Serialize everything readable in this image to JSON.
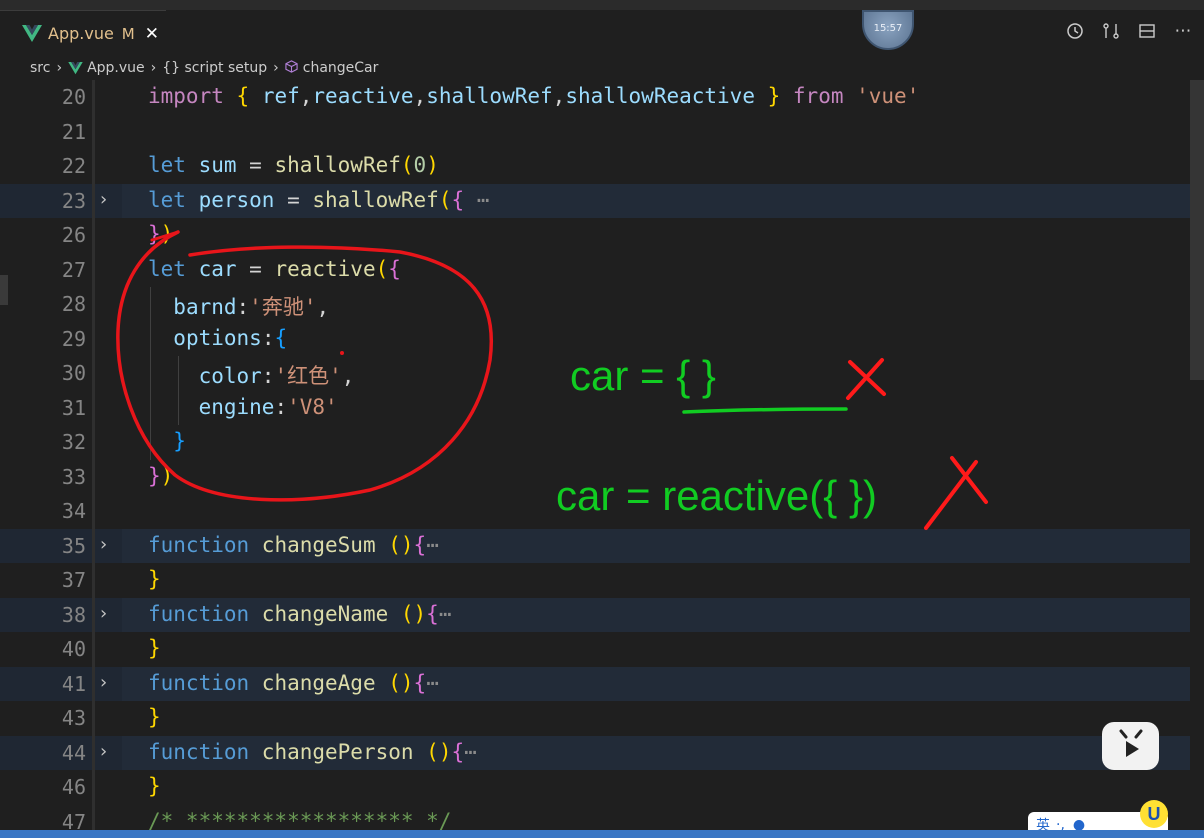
{
  "tab": {
    "filename": "App.vue",
    "modified": "M",
    "close": "✕"
  },
  "clock": {
    "time": "15:57"
  },
  "breadcrumb": {
    "items": [
      "src",
      "App.vue",
      "{} script setup",
      "changeCar"
    ]
  },
  "editor": {
    "lines": [
      {
        "num": "20",
        "folded": false
      },
      {
        "num": "21",
        "folded": false
      },
      {
        "num": "22",
        "folded": false
      },
      {
        "num": "23",
        "folded": true
      },
      {
        "num": "26",
        "folded": false
      },
      {
        "num": "27",
        "folded": false
      },
      {
        "num": "28",
        "folded": false
      },
      {
        "num": "29",
        "folded": false
      },
      {
        "num": "30",
        "folded": false
      },
      {
        "num": "31",
        "folded": false
      },
      {
        "num": "32",
        "folded": false
      },
      {
        "num": "33",
        "folded": false
      },
      {
        "num": "34",
        "folded": false
      },
      {
        "num": "35",
        "folded": true
      },
      {
        "num": "37",
        "folded": false
      },
      {
        "num": "38",
        "folded": true
      },
      {
        "num": "40",
        "folded": false
      },
      {
        "num": "41",
        "folded": true
      },
      {
        "num": "43",
        "folded": false
      },
      {
        "num": "44",
        "folded": true
      },
      {
        "num": "46",
        "folded": false
      },
      {
        "num": "47",
        "folded": false
      }
    ],
    "code": {
      "l20_import": "import",
      "l20_open": "{",
      "l20_ref": " ref",
      "l20_comma1": ",",
      "l20_reactive": "reactive",
      "l20_comma2": ",",
      "l20_shallowRef": "shallowRef",
      "l20_comma3": ",",
      "l20_shallowReactive": "shallowReactive",
      "l20_close": " }",
      "l20_from": " from ",
      "l20_vue": "'vue'",
      "l22_let": "let",
      "l22_sum": " sum",
      "l22_eq": " = ",
      "l22_fn": "shallowRef",
      "l22_p1": "(",
      "l22_zero": "0",
      "l22_p2": ")",
      "l23_let": "let",
      "l23_person": " person",
      "l23_eq": " = ",
      "l23_fn": "shallowRef",
      "l23_p1": "(",
      "l23_b1": "{",
      "l23_dots": " ⋯",
      "l26_b": "}",
      "l26_p": ")",
      "l27_let": "let",
      "l27_car": " car",
      "l27_eq": " = ",
      "l27_fn": "reactive",
      "l27_p": "(",
      "l27_b": "{",
      "l28_key": "barnd",
      "l28_colon": ":",
      "l28_val": "'奔驰'",
      "l28_comma": ",",
      "l29_key": "options",
      "l29_colon": ":",
      "l29_b": "{",
      "l30_key": "color",
      "l30_colon": ":",
      "l30_val": "'红色'",
      "l30_comma": ",",
      "l31_key": "engine",
      "l31_colon": ":",
      "l31_val": "'V8'",
      "l32_b": "}",
      "l33_b": "}",
      "l33_p": ")",
      "fn_kw": "function",
      "l35_name": " changeSum",
      "l35_rest": " ()",
      "l35_b": "{",
      "l35_dots": "⋯",
      "l37_b": "}",
      "l38_name": " changeName",
      "l38_rest": " ()",
      "l38_b": "{",
      "l38_dots": "⋯",
      "l40_b": "}",
      "l41_name": " changeAge",
      "l41_rest": " ()",
      "l41_b": "{",
      "l41_dots": "⋯",
      "l43_b": "}",
      "l44_name": " changePerson",
      "l44_rest": " ()",
      "l44_b": "{",
      "l44_dots": "⋯",
      "l46_b": "}",
      "l47_comment": "/* ****************** */"
    }
  },
  "annotations": {
    "line1": "car = {   }",
    "line2": "car = reactive({  })",
    "color": "#11cc22",
    "mark_color": "#ff1a1a"
  },
  "ime": {
    "label": "英",
    "punct": "·,",
    "badge": "U"
  }
}
